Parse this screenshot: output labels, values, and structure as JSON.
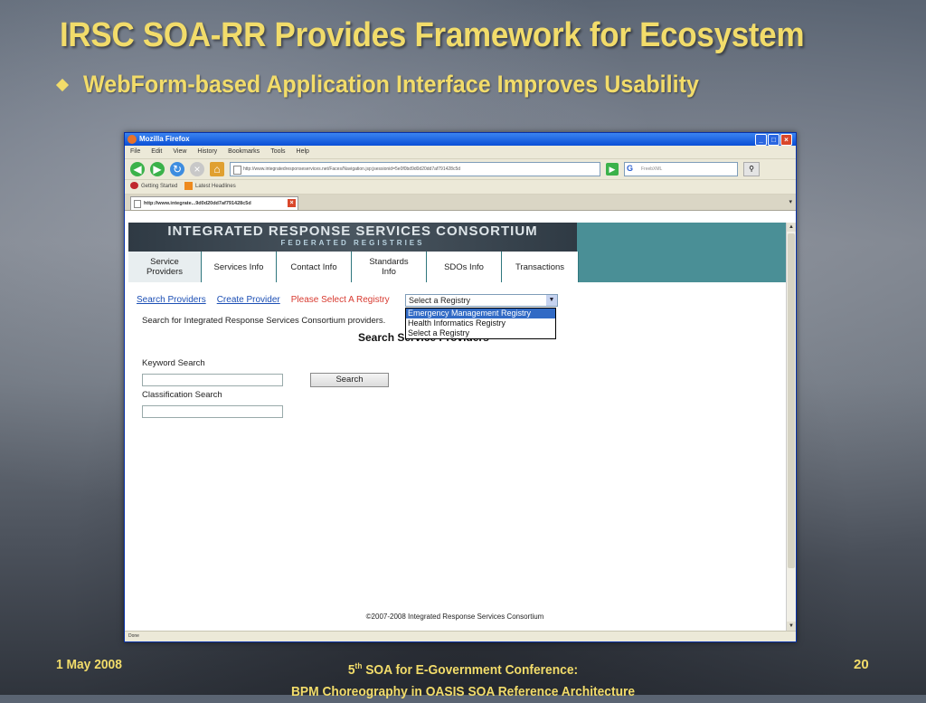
{
  "slide": {
    "title": "IRSC SOA-RR Provides Framework for Ecosystem",
    "bullet": "WebForm-based Application Interface Improves Usability",
    "footer_date": "1 May 2008",
    "footer_line1_num": "5",
    "footer_line1_sup": "th",
    "footer_line1_rest": " SOA for E-Government Conference:",
    "footer_line2": "BPM Choreography in OASIS SOA Reference Architecture",
    "page_number": "20"
  },
  "browser": {
    "window_title": "Mozilla Firefox",
    "menu": [
      "File",
      "Edit",
      "View",
      "History",
      "Bookmarks",
      "Tools",
      "Help"
    ],
    "url": "http://www.integratedresponseservices.net/Faces/Navigation.jsp;jsessionid=5e0f0bd9d0d20dd7af791428c5d",
    "search_placeholder": "FreebXML",
    "bookmarks": [
      "Getting Started",
      "Latest Headlines"
    ],
    "tab_title": "http://www.integrate...9d0d20dd7af791428c5d",
    "status": "Done"
  },
  "page": {
    "banner_title": "INTEGRATED RESPONSE SERVICES CONSORTIUM",
    "banner_subtitle": "FEDERATED REGISTRIES",
    "nav_tabs": [
      {
        "label": "Service\nProviders"
      },
      {
        "label": "Services Info"
      },
      {
        "label": "Contact Info"
      },
      {
        "label": "Standards\nInfo"
      },
      {
        "label": "SDOs Info"
      },
      {
        "label": "Transactions"
      }
    ],
    "link_search": "Search Providers",
    "link_create": "Create Provider",
    "registry_warning": "Please Select A Registry",
    "registry_selected": "Select a Registry",
    "registry_options": [
      "Emergency Management Registry",
      "Health Informatics Registry",
      "Select a Registry"
    ],
    "description": "Search for Integrated Response Services Consortium providers.",
    "heading": "Search Service Providers",
    "keyword_label": "Keyword Search",
    "search_button": "Search",
    "classification_label": "Classification Search",
    "copyright": "©2007-2008 Integrated Response Services Consortium"
  }
}
